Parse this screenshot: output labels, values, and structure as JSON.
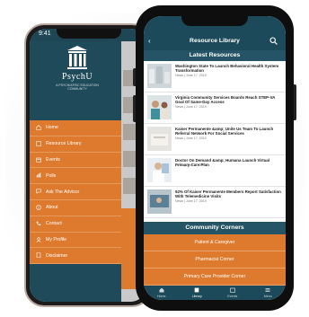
{
  "back_phone": {
    "status_time": "9:41",
    "logo": {
      "name": "PsychU",
      "tagline": "A PSYCHIATRIC EDUCATION COMMUNITY"
    },
    "menu": [
      {
        "label": "Home",
        "icon": "home-icon"
      },
      {
        "label": "Resource Library",
        "icon": "book-icon"
      },
      {
        "label": "Events",
        "icon": "calendar-icon"
      },
      {
        "label": "Polls",
        "icon": "chart-icon"
      },
      {
        "label": "Ask The Advisor",
        "icon": "chat-icon"
      },
      {
        "label": "About",
        "icon": "info-icon"
      },
      {
        "label": "Contact",
        "icon": "phone-icon"
      },
      {
        "label": "My Profile",
        "icon": "user-icon"
      },
      {
        "label": "Disclaimer",
        "icon": "document-icon"
      }
    ]
  },
  "front_phone": {
    "app_title": "Resource Library",
    "latest_heading": "Latest Resources",
    "news": [
      {
        "title": "Washington State To Launch Behavioral Health System Transformation",
        "meta": "News | June 17, 2019"
      },
      {
        "title": "Virginia Community Services Boards Reach STEP-VA Goal Of Same-Day Access",
        "meta": "News | June 17, 2019"
      },
      {
        "title": "Kaiser Permanente &amp; Unite Us Team To Launch Referral Network For Social Services",
        "meta": "News | June 17, 2019"
      },
      {
        "title": "Doctor On Demand &amp; Humana Launch Virtual Primary Care Plan",
        "meta": "News | June 17, 2019"
      },
      {
        "title": "92% Of Kaiser Permanente Members Report Satisfaction With Telemedicine Visits",
        "meta": "News | June 17, 2019"
      }
    ],
    "corners_heading": "Community Corners",
    "corners": [
      "Patient & Caregiver",
      "Pharmacist Corner",
      "Primary Care Provider Corner"
    ],
    "tabs": [
      {
        "label": "Home",
        "icon": "home-icon"
      },
      {
        "label": "Library",
        "icon": "book-icon"
      },
      {
        "label": "Events",
        "icon": "calendar-icon"
      },
      {
        "label": "Menu",
        "icon": "menu-icon"
      }
    ]
  },
  "colors": {
    "teal": "#1d4a5a",
    "orange": "#dd7a2e"
  }
}
